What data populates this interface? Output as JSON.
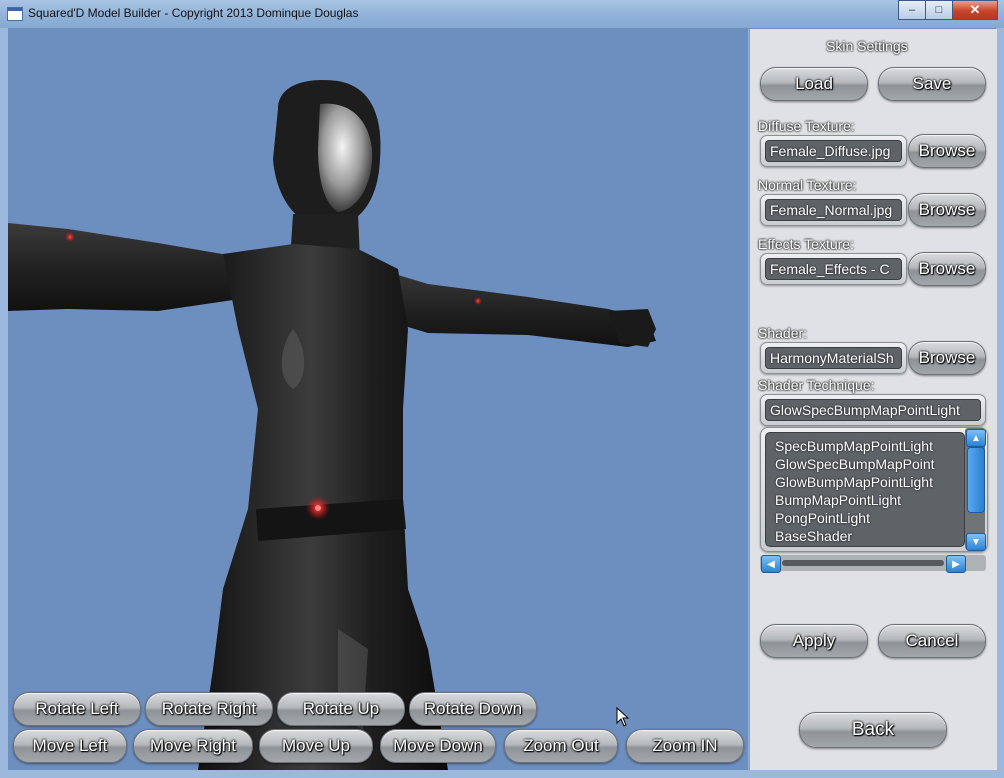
{
  "window": {
    "title": "Squared'D Model Builder - Copyright 2013 Dominque Douglas",
    "minimize": "–",
    "maximize": "□",
    "close": "✕"
  },
  "view_controls": {
    "rotate_left": "Rotate Left",
    "rotate_right": "Rotate Right",
    "rotate_up": "Rotate Up",
    "rotate_down": "Rotate Down",
    "move_left": "Move Left",
    "move_right": "Move Right",
    "move_up": "Move Up",
    "move_down": "Move Down",
    "zoom_out": "Zoom Out",
    "zoom_in": "Zoom IN"
  },
  "skin_panel": {
    "title": "Skin Settings",
    "load": "Load",
    "save": "Save",
    "diffuse_label": "Diffuse Texture:",
    "diffuse_value": "Female_Diffuse.jpg",
    "normal_label": "Normal Texture:",
    "normal_value": "Female_Normal.jpg",
    "effects_label": "Effects Texture:",
    "effects_value": "Female_Effects - C",
    "browse": "Browse",
    "shader_label": "Shader:",
    "shader_value": "HarmonyMaterialSh",
    "technique_label": "Shader Technique:",
    "technique_value": "GlowSpecBumpMapPointLight",
    "techniques": [
      "SpecBumpMapPointLight",
      "GlowSpecBumpMapPoint",
      "GlowBumpMapPointLight",
      "BumpMapPointLight",
      "PongPointLight",
      "BaseShader"
    ],
    "apply": "Apply",
    "cancel": "Cancel",
    "back": "Back"
  },
  "icons": {
    "scroll_up": "▲",
    "scroll_down": "▼",
    "scroll_left": "◀",
    "scroll_right": "▶"
  }
}
